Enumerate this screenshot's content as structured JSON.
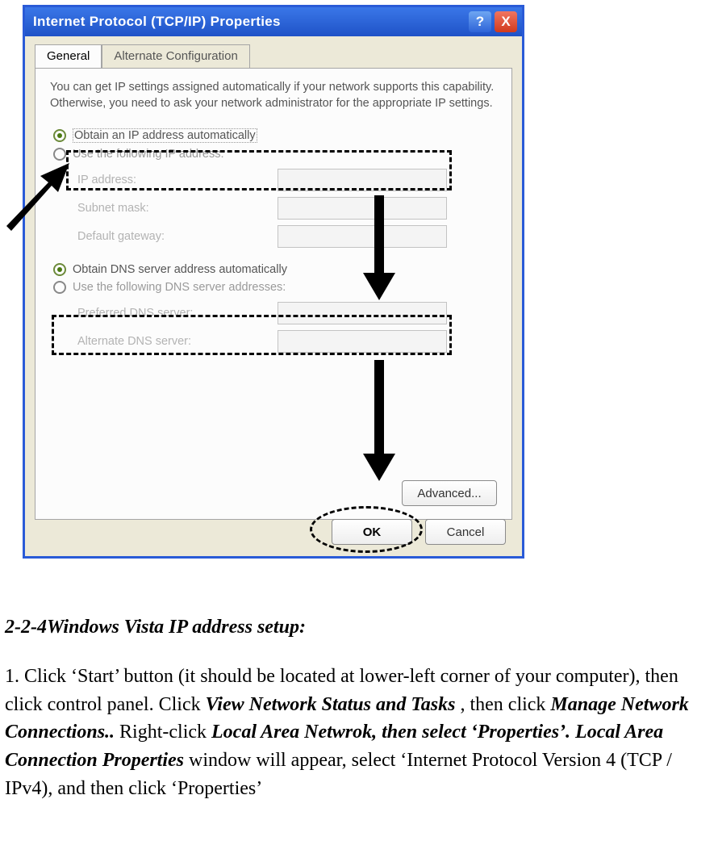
{
  "dialog": {
    "title": "Internet Protocol (TCP/IP) Properties",
    "help_tooltip": "?",
    "close_tooltip": "X",
    "tabs": {
      "general": "General",
      "alternate": "Alternate Configuration"
    },
    "description": "You can get IP settings assigned automatically if your network supports this capability. Otherwise, you need to ask your network administrator for the appropriate IP settings.",
    "ip": {
      "auto": "Obtain an IP address automatically",
      "manual": "Use the following IP address:",
      "ip_address": "IP address:",
      "subnet": "Subnet mask:",
      "gateway": "Default gateway:"
    },
    "dns": {
      "auto": "Obtain DNS server address automatically",
      "manual": "Use the following DNS server addresses:",
      "preferred": "Preferred DNS server:",
      "alternate": "Alternate DNS server:"
    },
    "advanced": "Advanced...",
    "ok": "OK",
    "cancel": "Cancel"
  },
  "article": {
    "heading": "2-2-4Windows Vista IP address setup:",
    "p1a": "1. Click ‘Start’ button (it should be located at lower-left corner of your computer), then click control panel. Click ",
    "p1b": "View Network Status and Tasks",
    "p1c": ", then click ",
    "p1d": "Manage Network Connections..",
    "p1e": "Right-click ",
    "p1f": "Local Area Netwrok, then select ‘Properties’. Local Area Connection Properties",
    "p1g": " window will appear, select ‘Internet Protocol Version 4 (TCP / IPv4), and then click ‘Properties’"
  }
}
